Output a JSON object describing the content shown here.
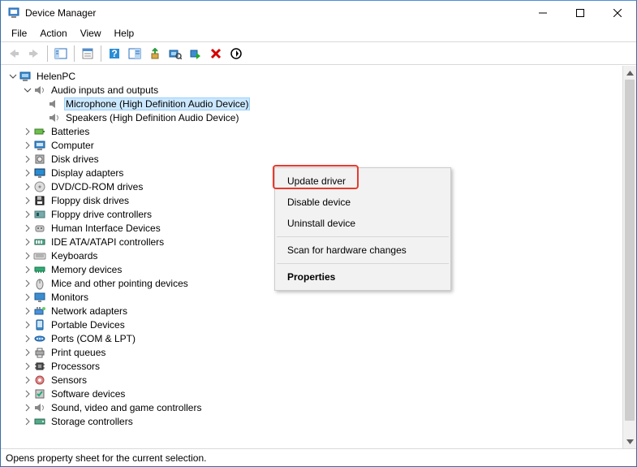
{
  "window": {
    "title": "Device Manager"
  },
  "menu": {
    "file": "File",
    "action": "Action",
    "view": "View",
    "help": "Help"
  },
  "toolbar": {
    "back": "Back",
    "forward": "Forward",
    "show_hide": "Show/Hide Console Tree",
    "properties": "Properties",
    "help": "Help",
    "action_center": "Action",
    "update": "Update driver",
    "uninstall": "Uninstall device",
    "scan": "Scan for hardware changes",
    "add_legacy": "Add legacy hardware",
    "disable": "Disable device"
  },
  "tree": {
    "root": "HelenPC",
    "audio": {
      "label": "Audio inputs and outputs",
      "mic": "Microphone (High Definition Audio Device)",
      "speakers": "Speakers (High Definition Audio Device)"
    },
    "categories": [
      "Batteries",
      "Computer",
      "Disk drives",
      "Display adapters",
      "DVD/CD-ROM drives",
      "Floppy disk drives",
      "Floppy drive controllers",
      "Human Interface Devices",
      "IDE ATA/ATAPI controllers",
      "Keyboards",
      "Memory devices",
      "Mice and other pointing devices",
      "Monitors",
      "Network adapters",
      "Portable Devices",
      "Ports (COM & LPT)",
      "Print queues",
      "Processors",
      "Sensors",
      "Software devices",
      "Sound, video and game controllers",
      "Storage controllers"
    ],
    "icons": [
      "battery",
      "computer",
      "disk",
      "display",
      "dvd",
      "floppy",
      "floppy-controller",
      "hid",
      "ide",
      "keyboard",
      "memory",
      "mouse",
      "monitor",
      "network",
      "portable",
      "port",
      "printer",
      "cpu",
      "sensor",
      "software",
      "sound",
      "storage"
    ]
  },
  "context_menu": {
    "update": "Update driver",
    "disable": "Disable device",
    "uninstall": "Uninstall device",
    "scan": "Scan for hardware changes",
    "properties": "Properties"
  },
  "statusbar": {
    "text": "Opens property sheet for the current selection."
  }
}
